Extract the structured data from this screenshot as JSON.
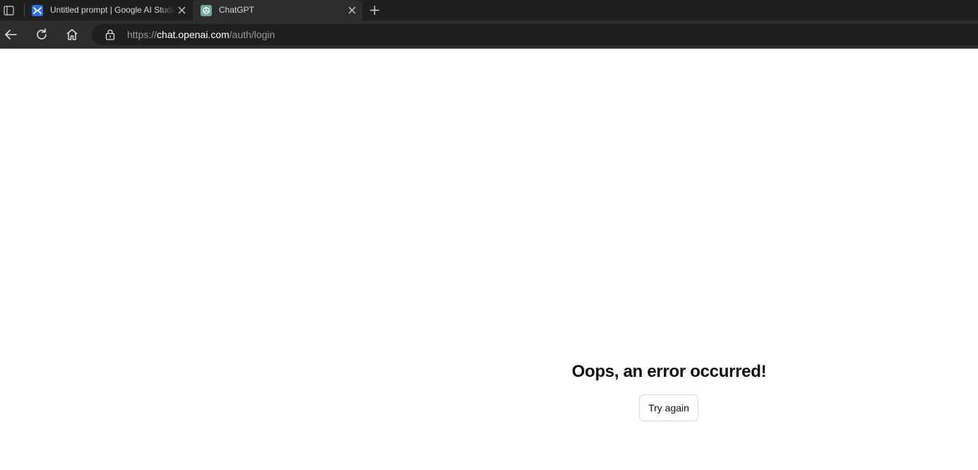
{
  "browser": {
    "tabs": [
      {
        "title": "Untitled prompt | Google AI Studio",
        "favicon": "google-ai-studio-icon",
        "active": false
      },
      {
        "title": "ChatGPT",
        "favicon": "chatgpt-icon",
        "active": true
      }
    ],
    "address": {
      "scheme": "https://",
      "host": "chat.openai.com",
      "path": "/auth/login"
    }
  },
  "page": {
    "error_title": "Oops, an error occurred!",
    "retry_label": "Try again"
  },
  "colors": {
    "tabstrip_bg": "#1f1f1f",
    "toolbar_bg": "#2d2d2d",
    "page_bg": "#ffffff",
    "ai_studio_blue": "#2f6fe4",
    "chatgpt_green": "#74aa9c"
  }
}
